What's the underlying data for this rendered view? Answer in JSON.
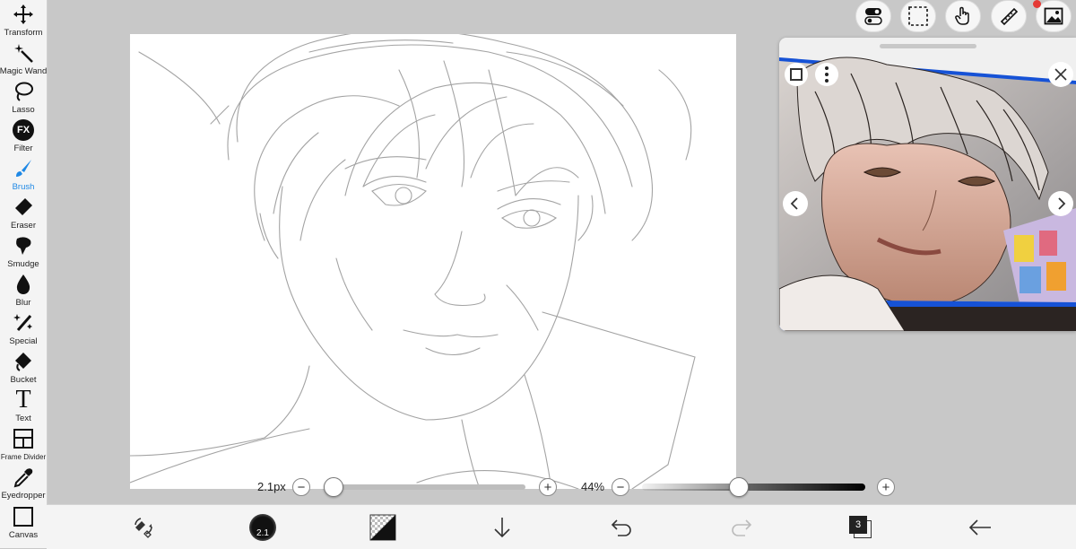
{
  "tools": [
    {
      "key": "transform",
      "label": "Transform",
      "icon": "move-arrows-icon"
    },
    {
      "key": "magic-wand",
      "label": "Magic Wand",
      "icon": "magic-wand-icon"
    },
    {
      "key": "lasso",
      "label": "Lasso",
      "icon": "lasso-icon"
    },
    {
      "key": "filter",
      "label": "Filter",
      "icon": "fx-icon",
      "glyph": "FX"
    },
    {
      "key": "brush",
      "label": "Brush",
      "icon": "brush-icon"
    },
    {
      "key": "eraser",
      "label": "Eraser",
      "icon": "eraser-icon"
    },
    {
      "key": "smudge",
      "label": "Smudge",
      "icon": "smudge-icon"
    },
    {
      "key": "blur",
      "label": "Blur",
      "icon": "blur-drop-icon"
    },
    {
      "key": "special",
      "label": "Special",
      "icon": "special-wand-icon"
    },
    {
      "key": "bucket",
      "label": "Bucket",
      "icon": "bucket-icon"
    },
    {
      "key": "text",
      "label": "Text",
      "icon": "text-icon",
      "glyph": "T"
    },
    {
      "key": "frame-divider",
      "label": "Frame Divider",
      "icon": "frame-divider-icon"
    },
    {
      "key": "eyedropper",
      "label": "Eyedropper",
      "icon": "eyedropper-icon"
    },
    {
      "key": "canvas",
      "label": "Canvas",
      "icon": "canvas-icon"
    }
  ],
  "active_tool": "brush",
  "brush": {
    "size_label": "2.1px",
    "opacity_label": "44%",
    "size_badge": "2.1"
  },
  "layers": {
    "count": "3"
  },
  "colors": {
    "accent": "#1e88e5",
    "ref_blue": "#1652d6",
    "notification": "#e53935"
  }
}
